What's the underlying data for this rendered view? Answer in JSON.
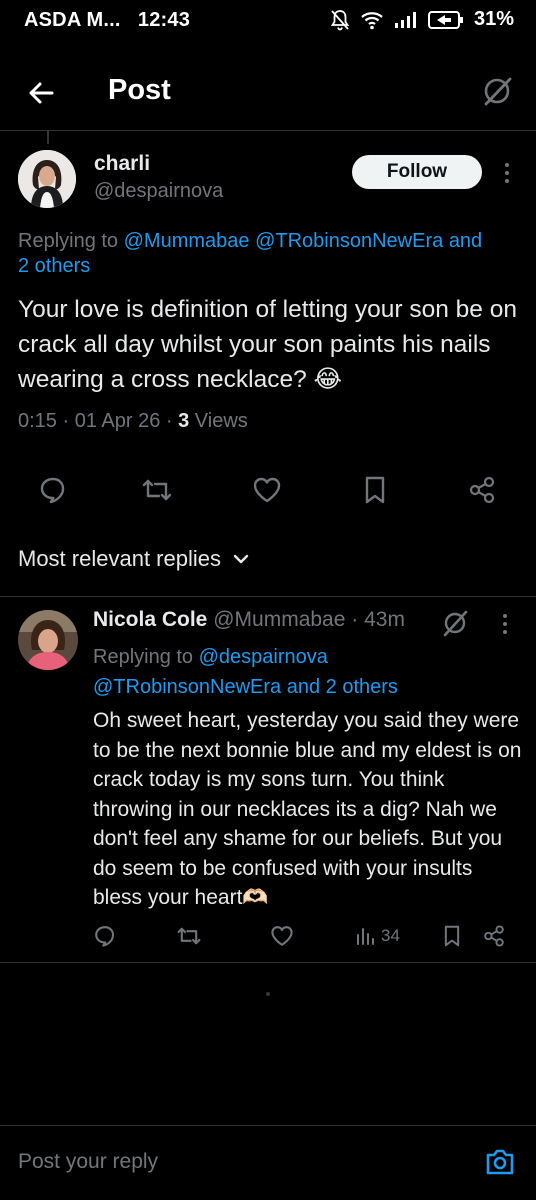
{
  "status_bar": {
    "carrier": "ASDA M...",
    "time": "12:43",
    "battery": "31%",
    "icons": [
      "mute-bell-icon",
      "wifi-icon",
      "signal-icon",
      "battery-icon"
    ]
  },
  "header": {
    "title": "Post",
    "back_icon": "arrow-left-icon",
    "grok_icon": "grok-icon"
  },
  "post": {
    "author_name": "charli",
    "author_handle": "@despairnova",
    "follow_label": "Follow",
    "replying_prefix": "Replying to ",
    "replying_to_1": "@Mummabae",
    "replying_to_2": "@TRobinsonNewEra",
    "replying_to_tail": "and",
    "replying_others": "2 others",
    "text": "Your love is definition of letting your son be on crack all day whilst your son paints his nails wearing a cross necklace? 😂",
    "time": "0:15 · 01 Apr 26 · ",
    "views_count": "3",
    "views_label": " Views",
    "actions": [
      "reply-icon",
      "repost-icon",
      "like-icon",
      "bookmark-icon",
      "share-icon"
    ]
  },
  "sort": {
    "label": "Most relevant replies"
  },
  "reply": {
    "author_name": "Nicola Cole",
    "author_handle": "@Mummabae",
    "age": " · 43m",
    "replying_prefix": "Replying to ",
    "replying_to_1": "@despairnova",
    "replying_to_2": "@TRobinsonNewEra and 2 others",
    "text": "Oh sweet heart, yesterday you said they were to be the next bonnie blue and my eldest is on crack today is my sons turn. You think throwing in our necklaces its a dig? Nah we don't feel any shame for our beliefs. But you do seem to be confused with your insults bless your heart🫶🏻",
    "views": "34"
  },
  "composer": {
    "placeholder": "Post your reply",
    "camera_icon": "camera-icon"
  },
  "colors": {
    "background": "#000000",
    "text": "#e7e9ea",
    "muted": "#71767b",
    "link": "#1d9bf0",
    "divider": "#2f3336"
  }
}
